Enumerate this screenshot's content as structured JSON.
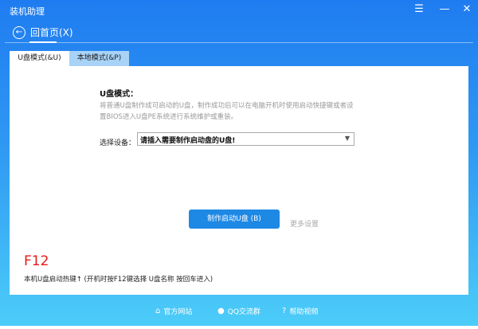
{
  "window": {
    "title": "装机助理",
    "menu_icon": "☰",
    "minimize_icon": "—",
    "close_icon": "✕"
  },
  "nav": {
    "back_label": "回首页(X)"
  },
  "tabs": [
    {
      "label": "U盘模式(&U)",
      "active": true
    },
    {
      "label": "本地模式(&P)",
      "active": false
    }
  ],
  "usb_mode": {
    "heading": "U盘模式：",
    "description": "将普通U盘制作成可启动的U盘，制作成功后可以在电脑开机时使用启动快捷键或者设置BIOS进入U盘PE系统进行系统维护或重装。",
    "device_label": "选择设备：",
    "device_value": "请插入需要制作启动盘的U盘!",
    "make_button": "制作启动U盘 (B)",
    "more_settings": "更多设置"
  },
  "hotkey": {
    "key": "F12",
    "text": "本机U盘启动热键↑ (开机时按F12键选择 U盘名称 按回车进入)"
  },
  "footer": [
    {
      "icon": "home-icon",
      "label": "官方网站"
    },
    {
      "icon": "qq-icon",
      "label": "QQ交流群"
    },
    {
      "icon": "help-icon",
      "label": "帮助视频"
    }
  ]
}
